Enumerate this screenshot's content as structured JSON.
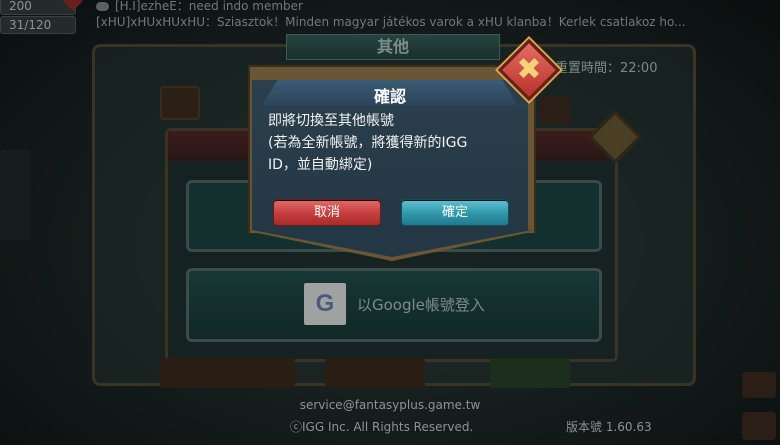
{
  "chat": {
    "line1": "[H.I]ezheE：need indo member",
    "line2": "[xHU]xHUxHUxHU：Sziasztok！Minden magyar játékos varok a xHU klanba！Kerlek csatlakoz ho..."
  },
  "resources": {
    "value1": "200",
    "value2": "31/120"
  },
  "background": {
    "header_title": "其他",
    "reset_time": "重置時間：22:00",
    "google_login_label": "以Google帳號登入",
    "google_icon_letter": "G",
    "service_email": "service@fantasyplus.game.tw",
    "copyright": "ⓒIGG Inc. All Rights Reserved.",
    "version": "版本號 1.60.63"
  },
  "dialog": {
    "title": "確認",
    "message_line1": "即將切換至其他帳號",
    "message_line2": "(若為全新帳號，將獲得新的IGG",
    "message_line3": "ID，並自動綁定)",
    "cancel_label": "取消",
    "confirm_label": "確定",
    "close_symbol": "✖"
  },
  "colors": {
    "cancel": "#c43d3d",
    "confirm": "#2f97ab",
    "dialog_frame": "#6a5634",
    "close_gold": "#f3d27a"
  }
}
